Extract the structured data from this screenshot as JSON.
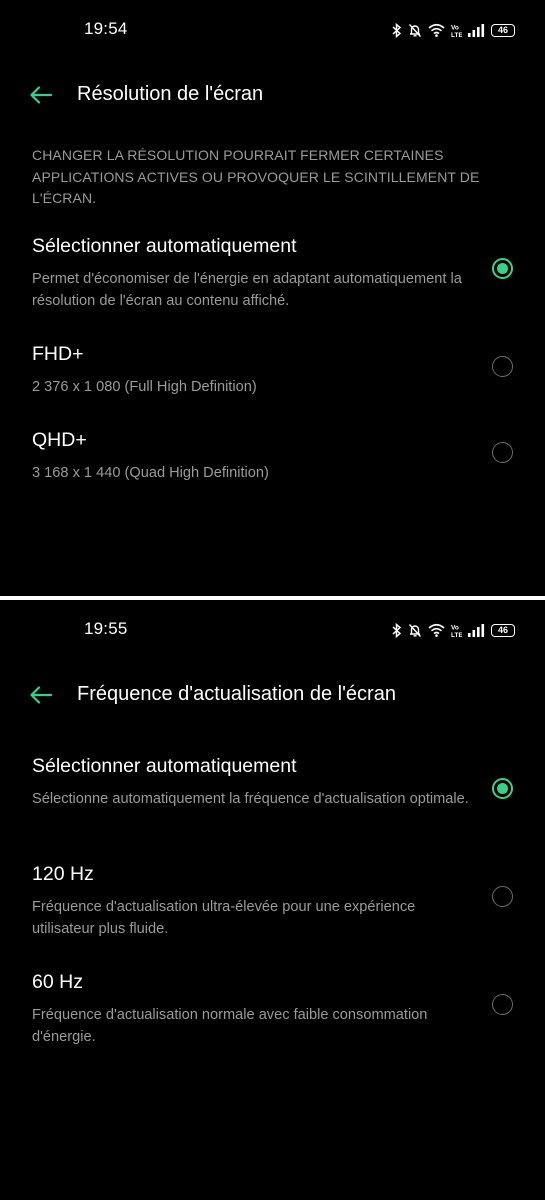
{
  "screen1": {
    "status": {
      "time": "19:54",
      "battery": "46"
    },
    "header": {
      "title": "Résolution de l'écran"
    },
    "warning": "CHANGER LA RÉSOLUTION POURRAIT FERMER CERTAINES APPLICATIONS ACTIVES OU PROVOQUER LE SCINTILLEMENT DE L'ÉCRAN.",
    "options": [
      {
        "title": "Sélectionner automatiquement",
        "desc": "Permet d'économiser de l'énergie en adaptant automatiquement la résolution de l'écran au contenu affiché.",
        "selected": true
      },
      {
        "title": "FHD+",
        "desc": "2 376 x 1 080 (Full High Definition)",
        "selected": false
      },
      {
        "title": "QHD+",
        "desc": "3 168 x 1 440 (Quad High Definition)",
        "selected": false
      }
    ]
  },
  "screen2": {
    "status": {
      "time": "19:55",
      "battery": "46"
    },
    "header": {
      "title": "Fréquence d'actualisation de l'écran"
    },
    "options": [
      {
        "title": "Sélectionner automatiquement",
        "desc": "Sélectionne automatiquement la fréquence d'actualisation optimale.",
        "selected": true
      },
      {
        "title": "120 Hz",
        "desc": "Fréquence d'actualisation ultra-élevée pour une expérience utilisateur plus fluide.",
        "selected": false
      },
      {
        "title": "60 Hz",
        "desc": "Fréquence d'actualisation normale avec faible consommation d'énergie.",
        "selected": false
      }
    ]
  },
  "colors": {
    "accent": "#35d38a",
    "background": "#000000",
    "secondary_text": "#9a9a9a"
  },
  "icons": [
    "back-arrow-icon",
    "bluetooth-icon",
    "mute-bell-icon",
    "wifi-icon",
    "volte-icon",
    "signal-icon",
    "battery-icon"
  ]
}
